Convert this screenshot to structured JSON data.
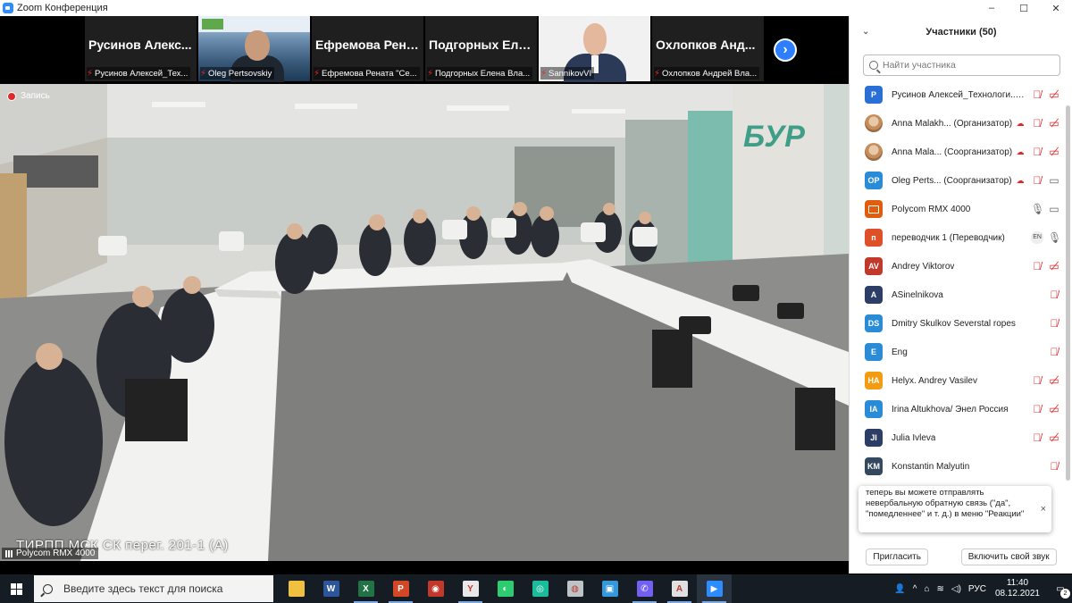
{
  "window": {
    "title": "Zoom Конференция",
    "controls": [
      "–",
      "☐",
      "✕"
    ]
  },
  "thumbnails": [
    {
      "name": "Русинов Алекс...",
      "label": "Русинов Алексей_Тех..."
    },
    {
      "name": "",
      "label": "Oleg Pertsovskiy"
    },
    {
      "name": "Ефремова Рена...",
      "label": "Ефремова Рената \"Се..."
    },
    {
      "name": "Подгорных Еле...",
      "label": "Подгорных Елена Вла..."
    },
    {
      "name": "",
      "label": "SannikovVI"
    },
    {
      "name": "Охлопков Анд...",
      "label": "Охлопков Андрей Вла..."
    }
  ],
  "main_video": {
    "recording_label": "Запись",
    "overlay_text": "ТИРПП МСК СК перег. 201-1 (А)",
    "source_label": "Polycom RMX 4000",
    "wall_logo": "БУР"
  },
  "participants_panel": {
    "title": "Участники (50)",
    "search_placeholder": "Найти участника",
    "participants": [
      {
        "initials": "P",
        "color": "#2a6fd6",
        "name": "Русинов Алексей_Технологи...(я)",
        "icons": [
          "mic-off",
          "video-off"
        ]
      },
      {
        "initials": "",
        "color": "photo",
        "name": "Anna Malakh... (Организатор)",
        "icons": [
          "cloud",
          "mic-off",
          "video-off"
        ]
      },
      {
        "initials": "",
        "color": "photo",
        "name": "Anna Mala... (Соорганизатор)",
        "icons": [
          "cloud",
          "mic-off",
          "video-off"
        ]
      },
      {
        "initials": "OP",
        "color": "#2a8bd6",
        "name": "Oleg Perts... (Соорганизатор)",
        "icons": [
          "cloud",
          "mic-off",
          "video-on"
        ]
      },
      {
        "initials": "",
        "color": "screen",
        "name": "Polycom RMX 4000",
        "icons": [
          "mic-on",
          "video-on"
        ]
      },
      {
        "initials": "п",
        "color": "#e05028",
        "name": "переводчик 1 (Переводчик)",
        "icons": [
          "en",
          "mic-on"
        ]
      },
      {
        "initials": "AV",
        "color": "#c0392b",
        "name": "Andrey Viktorov",
        "icons": [
          "mic-off",
          "video-off"
        ]
      },
      {
        "initials": "A",
        "color": "#2c3e66",
        "name": "ASinelnikova",
        "icons": [
          "mic-off"
        ]
      },
      {
        "initials": "DS",
        "color": "#2a8bd6",
        "name": "Dmitry Skulkov Severstal ropes",
        "icons": [
          "mic-off"
        ]
      },
      {
        "initials": "E",
        "color": "#2a8bd6",
        "name": "Eng",
        "icons": [
          "mic-off"
        ]
      },
      {
        "initials": "HA",
        "color": "#f39c12",
        "name": "Helyx. Andrey Vasilev",
        "icons": [
          "mic-off",
          "video-off"
        ]
      },
      {
        "initials": "IA",
        "color": "#2a8bd6",
        "name": "Irina Altukhova/ Энел Россия",
        "icons": [
          "mic-off",
          "video-off"
        ]
      },
      {
        "initials": "JI",
        "color": "#2c3e66",
        "name": "Julia Ivleva",
        "icons": [
          "mic-off",
          "video-off"
        ]
      },
      {
        "initials": "KM",
        "color": "#34495e",
        "name": "Konstantin Malyutin",
        "icons": [
          "mic-off"
        ]
      }
    ],
    "toast": {
      "text": "теперь вы можете отправлять невербальную обратную связь (\"да\", \"помедленнее\" и т. д.) в меню \"Реакции\"",
      "close": "×"
    },
    "invite_label": "Пригласить",
    "unmute_label": "Включить свой звук"
  },
  "taskbar": {
    "search_placeholder": "Введите здесь текст для поиска",
    "apps": [
      {
        "name": "file-explorer",
        "color": "#f0c040",
        "glyph": ""
      },
      {
        "name": "word",
        "color": "#2b579a",
        "glyph": "W"
      },
      {
        "name": "excel",
        "color": "#217346",
        "glyph": "X"
      },
      {
        "name": "powerpoint",
        "color": "#d24726",
        "glyph": "P"
      },
      {
        "name": "app-red",
        "color": "#c0392b",
        "glyph": "◉"
      },
      {
        "name": "yandex-browser",
        "color": "#e8e8e8",
        "glyph": "Y"
      },
      {
        "name": "app-green",
        "color": "#2ecc71",
        "glyph": "◐"
      },
      {
        "name": "app-teal",
        "color": "#1abc9c",
        "glyph": "◎"
      },
      {
        "name": "app-globe",
        "color": "#bdc3c7",
        "glyph": "◍"
      },
      {
        "name": "app-save",
        "color": "#3498db",
        "glyph": "▣"
      },
      {
        "name": "viber",
        "color": "#7360f2",
        "glyph": "✆"
      },
      {
        "name": "acrobat",
        "color": "#e0e0e0",
        "glyph": "A"
      },
      {
        "name": "zoom",
        "color": "#2d8cff",
        "glyph": "▶"
      }
    ],
    "tray": {
      "language": "РУС",
      "time": "11:40",
      "date": "08.12.2021",
      "notifications": "2"
    }
  }
}
